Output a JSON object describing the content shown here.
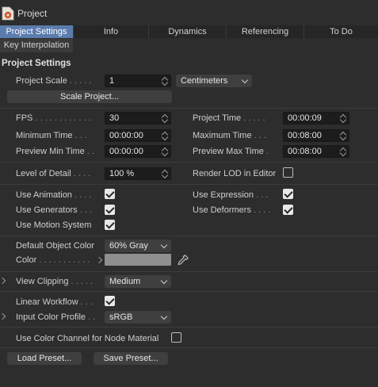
{
  "window": {
    "title": "Project"
  },
  "tabs": [
    "Project Settings",
    "Info",
    "Dynamics",
    "Referencing",
    "To Do"
  ],
  "tabs_row2": [
    "Key Interpolation"
  ],
  "section": {
    "title": "Project Settings"
  },
  "project_scale": {
    "label": "Project Scale",
    "dots": ". . . . .",
    "value": "1",
    "unit": "Centimeters"
  },
  "scale_project_button": "Scale Project...",
  "timing": {
    "fps": {
      "label": "FPS",
      "dots": ". . . . . . . . . . . .",
      "value": "30"
    },
    "project_time": {
      "label": "Project Time",
      "dots": ". . . . .",
      "value": "00:00:09"
    },
    "min_time": {
      "label": "Minimum Time",
      "dots": ". . .",
      "value": "00:00:00"
    },
    "max_time": {
      "label": "Maximum Time",
      "dots": ". . .",
      "value": "00:08:00"
    },
    "preview_min": {
      "label": "Preview Min Time",
      "dots": ". .",
      "value": "00:00:00"
    },
    "preview_max": {
      "label": "Preview Max Time",
      "dots": ".",
      "value": "00:08:00"
    }
  },
  "lod": {
    "label": "Level of Detail",
    "dots": ". . . .",
    "value": "100 %",
    "render_lod_label": "Render LOD in Editor",
    "render_lod_checked": false
  },
  "use": {
    "animation": {
      "label": "Use Animation",
      "dots": ". . . .",
      "checked": true
    },
    "expression": {
      "label": "Use Expression",
      "dots": ". . .",
      "checked": true
    },
    "generators": {
      "label": "Use Generators",
      "dots": ". . .",
      "checked": true
    },
    "deformers": {
      "label": "Use Deformers",
      "dots": ". . . .",
      "checked": true
    },
    "motion_system": {
      "label": "Use Motion System",
      "checked": true
    }
  },
  "object_color": {
    "label": "Default Object Color",
    "value": "60% Gray",
    "color_label": "Color",
    "color_dots": ". . . . . . . . . . .",
    "swatch_color": "#8f8f8f"
  },
  "view_clipping": {
    "label": "View Clipping",
    "dots": ". . . . .",
    "value": "Medium"
  },
  "linear_workflow": {
    "label": "Linear Workflow",
    "dots": ". . .",
    "checked": true
  },
  "input_color_profile": {
    "label": "Input Color Profile",
    "dots": ". .",
    "value": "sRGB"
  },
  "color_channel": {
    "label": "Use Color Channel for Node Material",
    "checked": false
  },
  "preset_buttons": {
    "load": "Load Preset...",
    "save": "Save Preset..."
  },
  "colors": {
    "accent": "#5b7cad",
    "background": "#2d2d2d"
  }
}
